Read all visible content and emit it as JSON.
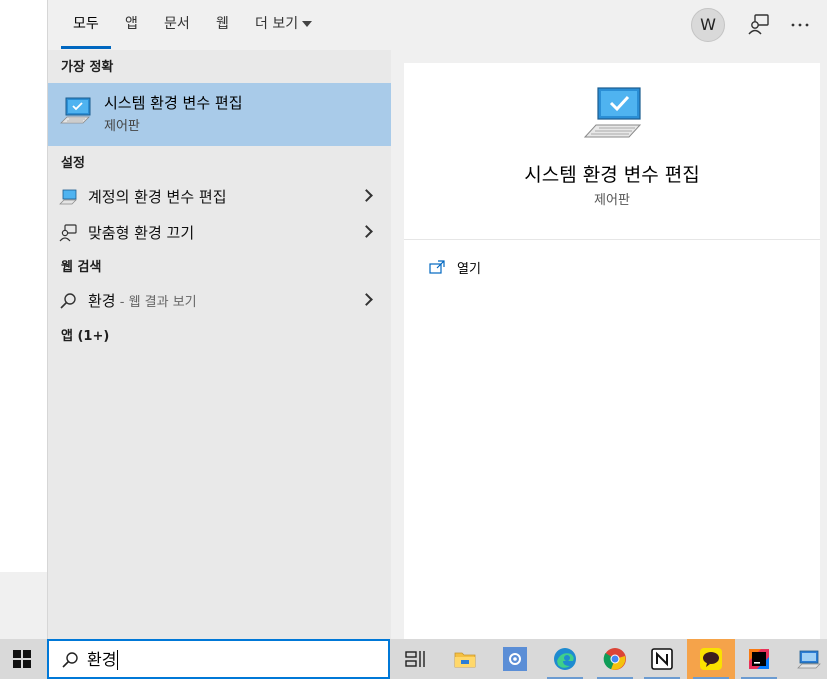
{
  "tabs": [
    {
      "label": "모두",
      "active": true
    },
    {
      "label": "앱"
    },
    {
      "label": "문서"
    },
    {
      "label": "웹"
    },
    {
      "label": "더 보기"
    }
  ],
  "avatar_initial": "W",
  "best_match": {
    "header": "가장 정확",
    "title": "시스템 환경 변수 편집",
    "subtitle": "제어판"
  },
  "settings": {
    "header": "설정",
    "items": [
      {
        "label": "계정의 환경 변수 편집",
        "icon": "monitor-icon"
      },
      {
        "label": "맞춤형 환경 끄기",
        "icon": "feedback-person-icon"
      }
    ]
  },
  "web_search": {
    "header": "웹 검색",
    "query": "환경",
    "suffix": " - 웹 결과 보기"
  },
  "apps_header": "앱 (1+)",
  "preview": {
    "title": "시스템 환경 변수 편집",
    "subtitle": "제어판",
    "open_label": "열기"
  },
  "search_box": {
    "value": "환경"
  },
  "colors": {
    "accent": "#0078d7",
    "selection": "#a9cbe9",
    "panel_bg": "#f0f0f0"
  }
}
